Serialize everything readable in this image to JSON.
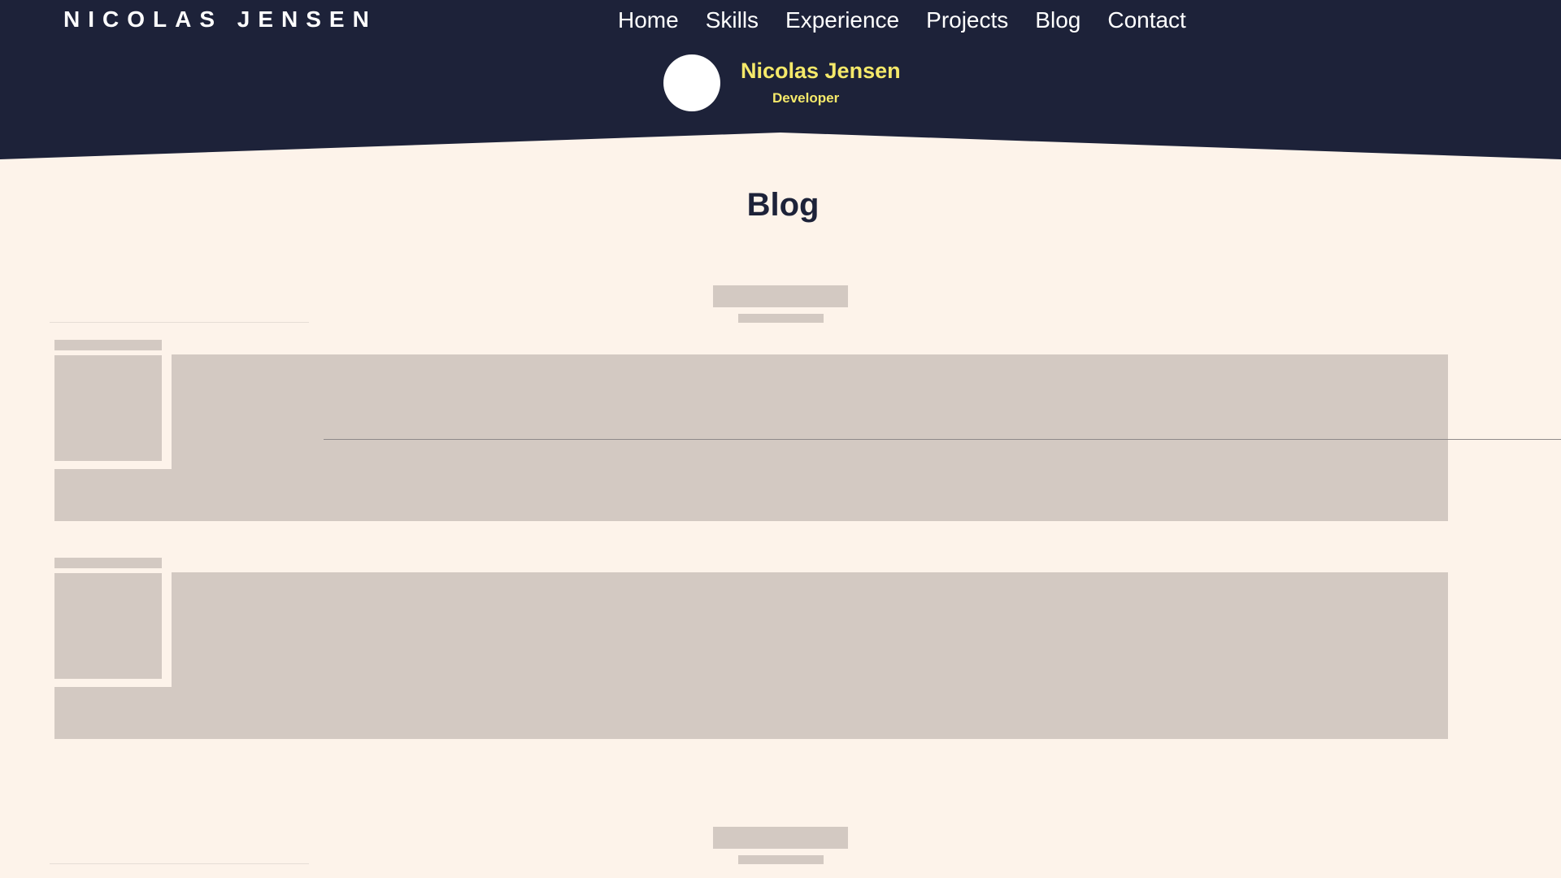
{
  "header": {
    "brand": "NICOLAS JENSEN",
    "nav": [
      "Home",
      "Skills",
      "Experience",
      "Projects",
      "Blog",
      "Contact"
    ],
    "profile": {
      "name": "Nicolas Jensen",
      "role": "Developer"
    }
  },
  "main": {
    "section_title": "Blog"
  },
  "colors": {
    "header_bg": "#1d2239",
    "page_bg": "#fdf3ea",
    "accent": "#f5e96a",
    "skeleton": "#d3c9c2",
    "title": "#1d2239"
  }
}
